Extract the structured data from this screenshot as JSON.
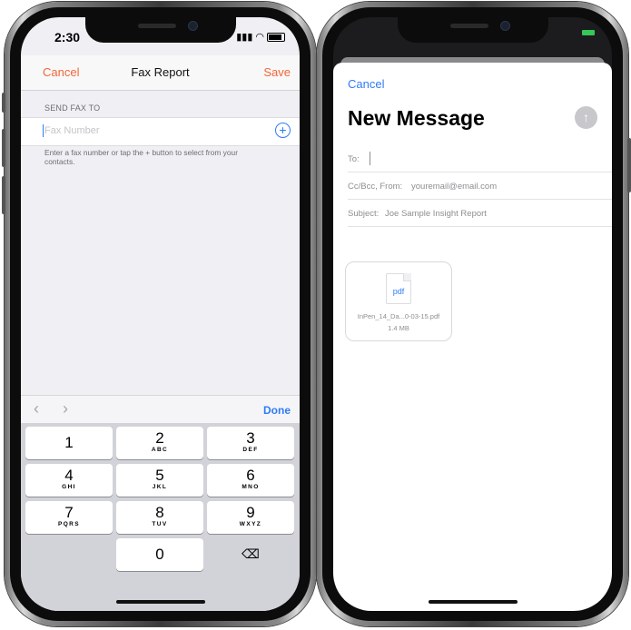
{
  "left_phone": {
    "status": {
      "time": "2:30"
    },
    "navbar": {
      "cancel": "Cancel",
      "title": "Fax Report",
      "save": "Save"
    },
    "section_header": "SEND FAX TO",
    "fax_input": {
      "placeholder": "Fax Number",
      "value": ""
    },
    "help_text": "Enter a fax number or tap the + button to select from your contacts.",
    "accessory": {
      "prev": "‹",
      "next": "›",
      "done": "Done"
    },
    "keypad": [
      {
        "num": "1",
        "letters": ""
      },
      {
        "num": "2",
        "letters": "ABC"
      },
      {
        "num": "3",
        "letters": "DEF"
      },
      {
        "num": "4",
        "letters": "GHI"
      },
      {
        "num": "5",
        "letters": "JKL"
      },
      {
        "num": "6",
        "letters": "MNO"
      },
      {
        "num": "7",
        "letters": "PQRS"
      },
      {
        "num": "8",
        "letters": "TUV"
      },
      {
        "num": "9",
        "letters": "WXYZ"
      },
      {
        "num": "0",
        "letters": ""
      }
    ],
    "icons": {
      "add": "plus-circle-icon",
      "delete": "backspace-icon"
    }
  },
  "right_phone": {
    "compose": {
      "cancel": "Cancel",
      "title": "New Message",
      "to_label": "To:",
      "ccbcc_label": "Cc/Bcc, From:",
      "from_value": "youremail@email.com",
      "subject_label": "Subject:",
      "subject_value": "Joe Sample Insight Report"
    },
    "attachment": {
      "type": "pdf",
      "name": "InPen_14_Da...0-03-15.pdf",
      "size": "1.4 MB"
    }
  },
  "colors": {
    "accent_orange": "#f2663a",
    "accent_blue": "#2f7cf6",
    "battery_green": "#35c759"
  }
}
